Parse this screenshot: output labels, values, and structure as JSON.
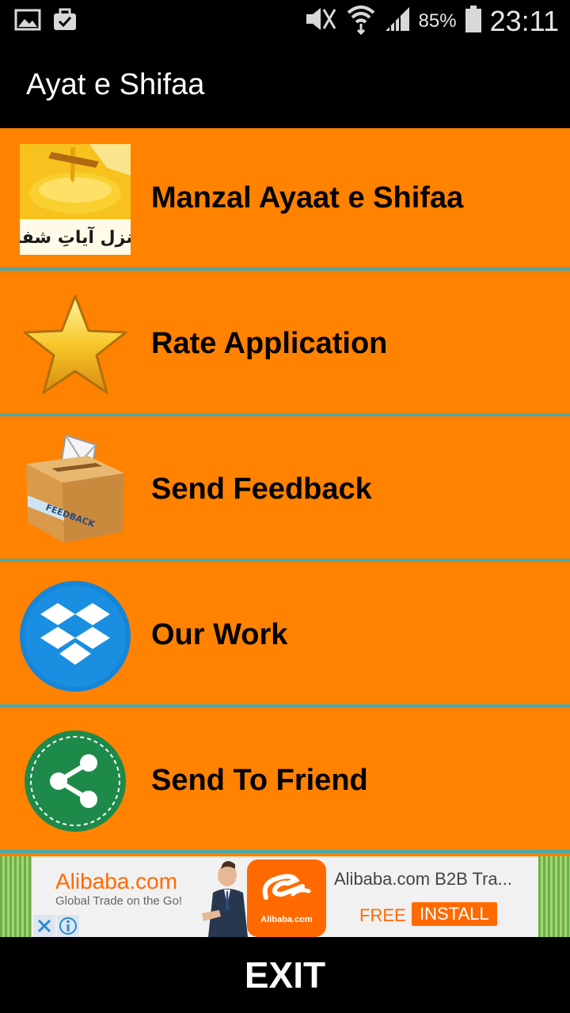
{
  "status_bar": {
    "battery_percent": "85%",
    "time": "23:11",
    "left_icons": [
      "image-icon",
      "briefcase-check-icon"
    ],
    "right_icons": [
      "mute-icon",
      "wifi-icon",
      "signal-icon",
      "battery-icon"
    ]
  },
  "app_bar": {
    "title": "Ayat e Shifaa"
  },
  "menu": {
    "items": [
      {
        "label": "Manzal Ayaat e Shifaa",
        "icon": "honey-thumbnail-icon",
        "thumb_text": "منزل آیاتِ شفاء"
      },
      {
        "label": "Rate Application",
        "icon": "star-icon"
      },
      {
        "label": "Send Feedback",
        "icon": "feedback-box-icon",
        "box_text": "FEEDBACK"
      },
      {
        "label": "Our Work",
        "icon": "dropbox-icon"
      },
      {
        "label": "Send To Friend",
        "icon": "share-icon"
      }
    ]
  },
  "ad": {
    "brand": "Alibaba.com",
    "tagline": "Global Trade on the Go!",
    "logo_text": "Alibaba.com",
    "headline": "Alibaba.com B2B Tra...",
    "free": "FREE",
    "install": "INSTALL",
    "accent": "#ff6a00"
  },
  "exit": {
    "label": "EXIT"
  },
  "colors": {
    "menu_bg": "#ff8200",
    "divider": "#4aa9a8",
    "bar_bg": "#000000"
  }
}
